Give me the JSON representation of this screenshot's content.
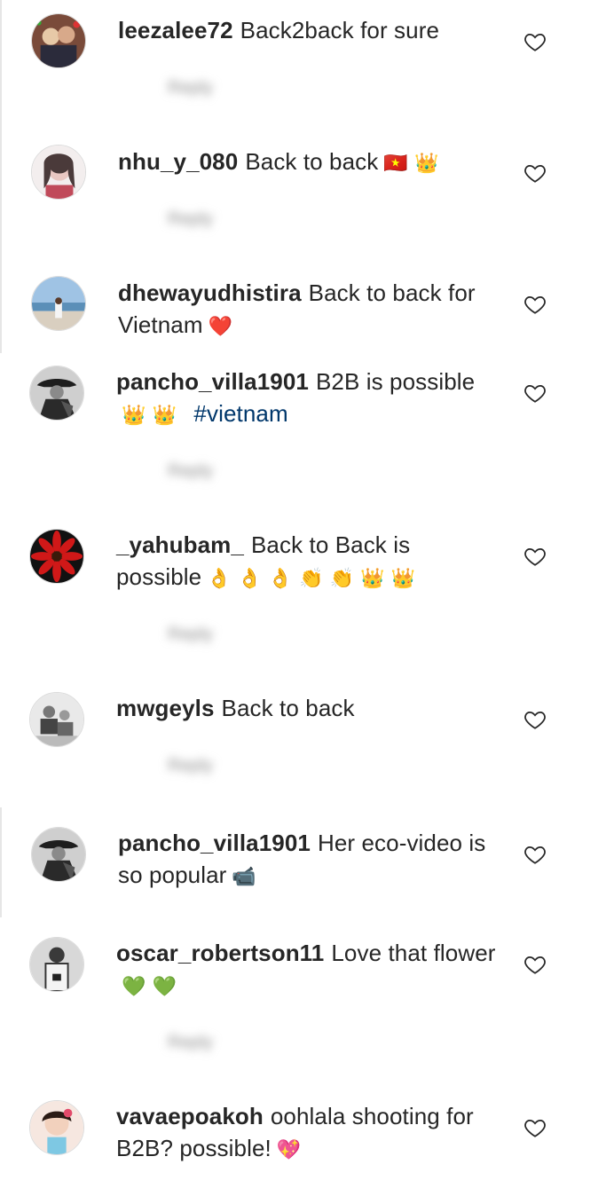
{
  "comments": [
    {
      "username": "leezalee72",
      "text": "Back2back for sure",
      "emoji": "",
      "hashtag": "",
      "meta": [
        "",
        "",
        "Reply"
      ]
    },
    {
      "username": "nhu_y_080",
      "text": "Back to back",
      "emoji": "🇻🇳 👑",
      "hashtag": "",
      "meta": [
        "",
        "",
        "Reply"
      ]
    },
    {
      "username": "dhewayudhistira",
      "text": "Back to back for Vietnam",
      "emoji": "❤️",
      "hashtag": "",
      "meta": []
    },
    {
      "username": "pancho_villa1901",
      "text": "B2B is possible",
      "emoji": "👑 👑",
      "hashtag": "#vietnam",
      "meta": [
        "",
        "",
        "Reply"
      ]
    },
    {
      "username": "_yahubam_",
      "text": "Back to Back is possible",
      "emoji": "👌 👌 👌 👏 👏 👑 👑",
      "hashtag": "",
      "meta": [
        "",
        "",
        "Reply"
      ]
    },
    {
      "username": "mwgeyls",
      "text": "Back to back",
      "emoji": "",
      "hashtag": "",
      "meta": [
        "",
        "",
        "Reply"
      ]
    },
    {
      "username": "pancho_villa1901",
      "text": "Her eco-video is so popular",
      "emoji": "📹",
      "hashtag": "",
      "meta": []
    },
    {
      "username": "oscar_robertson11",
      "text": "Love that flower",
      "emoji": "💚 💚",
      "hashtag": "",
      "meta": [
        "",
        "",
        "Reply"
      ]
    },
    {
      "username": "vavaepoakoh",
      "text": "oohlala shooting for B2B? possible!",
      "emoji": "💖",
      "hashtag": "",
      "meta": []
    }
  ]
}
